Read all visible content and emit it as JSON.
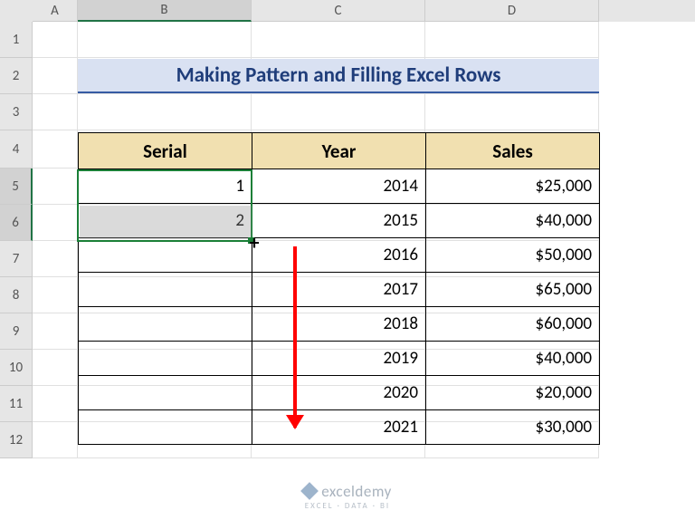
{
  "columns": [
    "A",
    "B",
    "C",
    "D"
  ],
  "selectedColumn": "B",
  "rows": [
    "1",
    "2",
    "3",
    "4",
    "5",
    "6",
    "7",
    "8",
    "9",
    "10",
    "11",
    "12"
  ],
  "selectedRows": [
    "5",
    "6"
  ],
  "title": "Making Pattern and Filling Excel Rows",
  "table": {
    "headers": {
      "serial": "Serial",
      "year": "Year",
      "sales": "Sales"
    },
    "rows": [
      {
        "serial": "1",
        "year": "2014",
        "sales": "$25,000"
      },
      {
        "serial": "2",
        "year": "2015",
        "sales": "$40,000"
      },
      {
        "serial": "",
        "year": "2016",
        "sales": "$50,000"
      },
      {
        "serial": "",
        "year": "2017",
        "sales": "$65,000"
      },
      {
        "serial": "",
        "year": "2018",
        "sales": "$60,000"
      },
      {
        "serial": "",
        "year": "2019",
        "sales": "$40,000"
      },
      {
        "serial": "",
        "year": "2020",
        "sales": "$20,000"
      },
      {
        "serial": "",
        "year": "2021",
        "sales": "$30,000"
      }
    ]
  },
  "watermark": {
    "brand": "exceldemy",
    "tagline": "EXCEL · DATA · BI"
  },
  "colors": {
    "selection": "#1a7f37",
    "headerFill": "#f1e0b0",
    "titleFill": "#d9e1f2",
    "arrow": "#ff0000"
  }
}
